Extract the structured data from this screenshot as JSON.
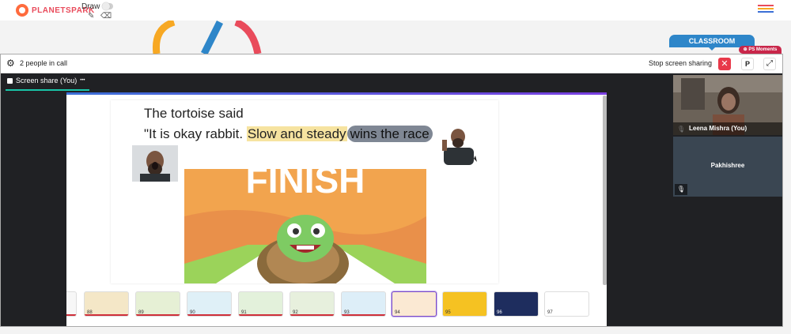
{
  "header": {
    "logo_text": "PLANETSPARK",
    "draw_label": "Draw",
    "menu_colors": [
      "#e94b5b",
      "#f7a823",
      "#3b6fd6"
    ]
  },
  "classroom_tab": "CLASSROOM",
  "call": {
    "people_label": "2 people in call",
    "stop_sharing_label": "Stop screen sharing",
    "p_button": "P",
    "close_icon": "✕",
    "expand_icon": "⤢",
    "moments_label": "PS Moments",
    "share_tab_label": "Screen share (You)",
    "more_icon": "•••"
  },
  "slide": {
    "line1": "The tortoise said",
    "line2_prefix": "\"It is okay rabbit. ",
    "highlight_yellow": "Slow and steady",
    "highlight_grey": "wins the race",
    "line2_suffix": "\"",
    "finish_text": "FINISH"
  },
  "thumbnails": [
    {
      "num": "88"
    },
    {
      "num": "89"
    },
    {
      "num": "90"
    },
    {
      "num": "91"
    },
    {
      "num": "92"
    },
    {
      "num": "93"
    },
    {
      "num": "94",
      "active": true
    },
    {
      "num": "95"
    },
    {
      "num": "96"
    },
    {
      "num": "97"
    }
  ],
  "participants": [
    {
      "name": "Leena Mishra (You)"
    },
    {
      "name": "Pakhishree"
    }
  ],
  "colors": {
    "accent_red": "#e8394a",
    "teal": "#19c5a8",
    "classroom_blue": "#2e86c9",
    "highlight_yellow": "#f6e3a0",
    "highlight_grey": "#7f8794"
  }
}
